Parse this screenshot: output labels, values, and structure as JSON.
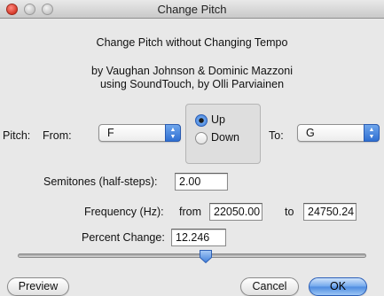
{
  "window": {
    "title": "Change Pitch"
  },
  "header": {
    "line1": "Change Pitch without Changing Tempo",
    "line2": "by Vaughan Johnson & Dominic Mazzoni",
    "line3": "using SoundTouch, by Olli Parviainen"
  },
  "pitch": {
    "label": "Pitch:",
    "from_label": "From:",
    "from_value": "F",
    "direction_up": "Up",
    "direction_down": "Down",
    "direction_selected": "Up",
    "to_label": "To:",
    "to_value": "G"
  },
  "semitones": {
    "label": "Semitones (half-steps):",
    "value": "2.00"
  },
  "frequency": {
    "label": "Frequency (Hz):",
    "from_label": "from",
    "from_value": "22050.00",
    "to_label": "to",
    "to_value": "24750.24"
  },
  "percent": {
    "label": "Percent Change:",
    "value": "12.246",
    "slider_position": 0.54
  },
  "buttons": {
    "preview": "Preview",
    "cancel": "Cancel",
    "ok": "OK"
  },
  "colors": {
    "accent": "#3d7ddb",
    "close_button": "#d63a2a"
  }
}
